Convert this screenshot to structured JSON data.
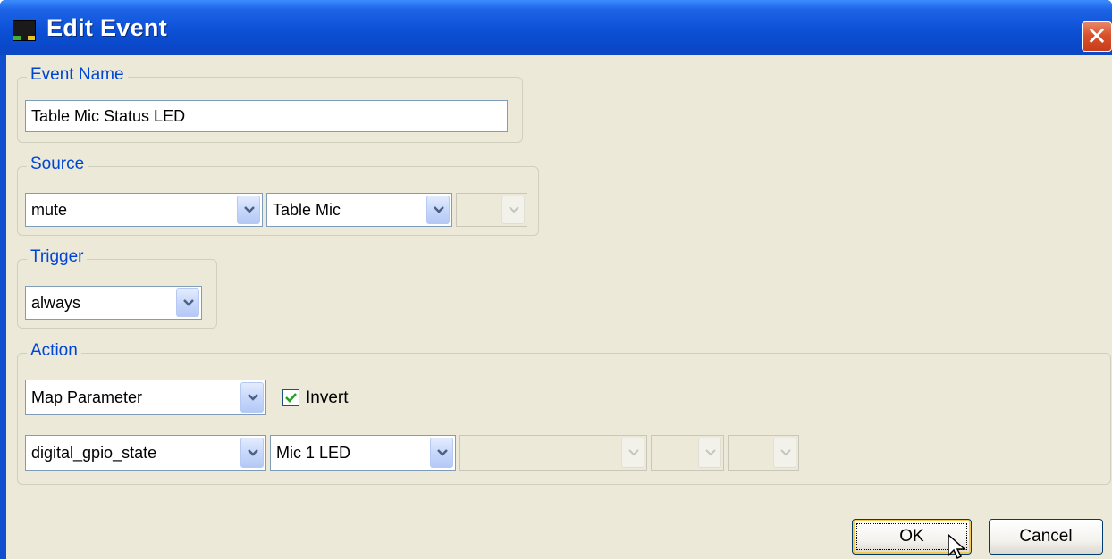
{
  "window": {
    "title": "Edit Event",
    "close_label": "✕"
  },
  "event_name": {
    "legend": "Event Name",
    "value": "Table Mic Status LED"
  },
  "source": {
    "legend": "Source",
    "combo1": "mute",
    "combo2": "Table Mic",
    "combo3": ""
  },
  "trigger": {
    "legend": "Trigger",
    "combo": "always"
  },
  "action": {
    "legend": "Action",
    "type": "Map Parameter",
    "invert_label": "Invert",
    "invert_checked": true,
    "param": "digital_gpio_state",
    "target": "Mic 1 LED",
    "extra1": "",
    "extra2": "",
    "extra3": ""
  },
  "buttons": {
    "ok": "OK",
    "cancel": "Cancel"
  },
  "colors": {
    "titlebar": "#0a48c9",
    "legend_text": "#0046d5",
    "dialog_bg": "#ece9d8",
    "close_button": "#d9512c"
  },
  "icons": [
    "app-icon",
    "close-icon",
    "chevron-down-icon",
    "checkmark-icon",
    "mouse-pointer-icon"
  ]
}
